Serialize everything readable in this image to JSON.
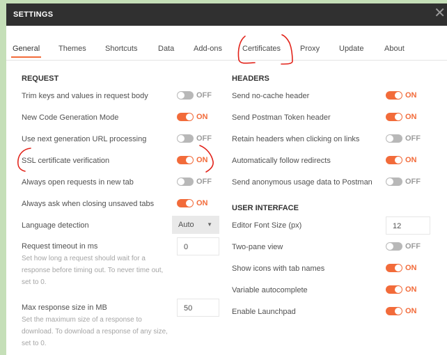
{
  "window": {
    "title": "SETTINGS",
    "close": "✕"
  },
  "tabs": [
    "General",
    "Themes",
    "Shortcuts",
    "Data",
    "Add-ons",
    "Certificates",
    "Proxy",
    "Update",
    "About"
  ],
  "request": {
    "heading": "REQUEST",
    "toggles": [
      {
        "label": "Trim keys and values in request body",
        "state": "OFF"
      },
      {
        "label": "New Code Generation Mode",
        "state": "ON"
      },
      {
        "label": "Use next generation URL processing",
        "state": "OFF"
      },
      {
        "label": "SSL certificate verification",
        "state": "ON"
      },
      {
        "label": "Always open requests in new tab",
        "state": "OFF"
      },
      {
        "label": "Always ask when closing unsaved tabs",
        "state": "ON"
      }
    ],
    "language": {
      "label": "Language detection",
      "value": "Auto",
      "arrow": "▼"
    },
    "timeout": {
      "label": "Request timeout in ms",
      "value": "0",
      "help": "Set how long a request should wait for a response before timing out. To never time out, set to 0."
    },
    "maxsize": {
      "label": "Max response size in MB",
      "value": "50",
      "help": "Set the maximum size of a response to download. To download a response of any size, set to 0."
    }
  },
  "headers": {
    "heading": "HEADERS",
    "toggles": [
      {
        "label": "Send no-cache header",
        "state": "ON"
      },
      {
        "label": "Send Postman Token header",
        "state": "ON"
      },
      {
        "label": "Retain headers when clicking on links",
        "state": "OFF"
      },
      {
        "label": "Automatically follow redirects",
        "state": "ON"
      },
      {
        "label": "Send anonymous usage data to Postman",
        "state": "OFF"
      }
    ]
  },
  "ui": {
    "heading": "USER INTERFACE",
    "font_size": {
      "label": "Editor Font Size (px)",
      "value": "12"
    },
    "toggles": [
      {
        "label": "Two-pane view",
        "state": "OFF"
      },
      {
        "label": "Show icons with tab names",
        "state": "ON"
      },
      {
        "label": "Variable autocomplete",
        "state": "ON"
      },
      {
        "label": "Enable Launchpad",
        "state": "ON"
      }
    ]
  },
  "colors": {
    "accent": "#f26b3a",
    "titlebar": "#303030",
    "annotation": "#e2231a",
    "background": "#c5dfb8"
  }
}
